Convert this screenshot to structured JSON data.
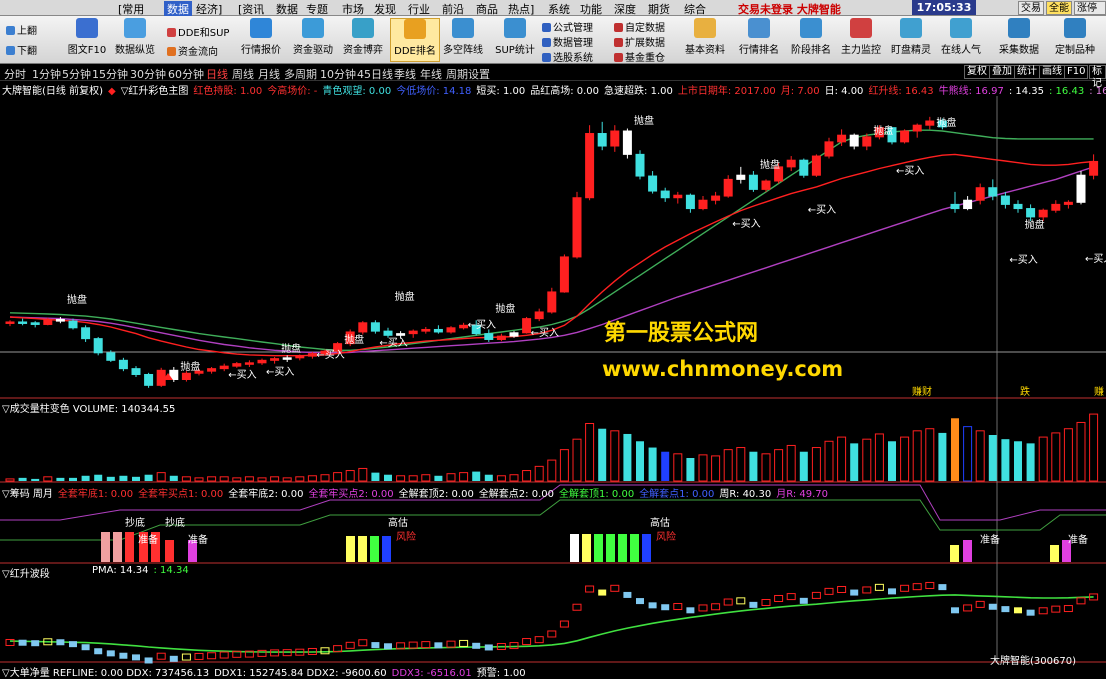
{
  "top_menu": {
    "items": [
      {
        "label": "[常用"
      },
      {
        "label": "数据",
        "active": true
      },
      {
        "label": "经济]"
      },
      {
        "label": "[资讯"
      },
      {
        "label": "数据"
      },
      {
        "label": "专题"
      },
      {
        "label": "市场"
      },
      {
        "label": "发现"
      },
      {
        "label": "行业"
      },
      {
        "label": "前沿"
      },
      {
        "label": "商品"
      },
      {
        "label": "热点]"
      },
      {
        "label": "系统"
      },
      {
        "label": "功能"
      },
      {
        "label": "深度"
      },
      {
        "label": "期货"
      },
      {
        "label": "综合"
      }
    ],
    "status": "交易未登录 大牌智能",
    "time": "17:05:33 日",
    "buttons": [
      "交易",
      "全能",
      "涨停王"
    ]
  },
  "toolbar": {
    "left_small": [
      "上翻",
      "下翻"
    ],
    "buttons": [
      {
        "label": "图文F10",
        "color": "#3b6fd0"
      },
      {
        "label": "数据纵览",
        "color": "#4a9ee0"
      },
      {
        "label": "行情报价",
        "color": "#2f86d8"
      },
      {
        "label": "资金驱动",
        "color": "#3c9bd8"
      },
      {
        "label": "资金博弈",
        "color": "#38a0c8"
      },
      {
        "label": "DDE排名",
        "color": "#e8a020",
        "active": true
      },
      {
        "label": "多空阵线",
        "color": "#3b8fd0"
      },
      {
        "label": "SUP统计",
        "color": "#3b8fd0"
      },
      {
        "label": "基本资料",
        "color": "#e8b040"
      },
      {
        "label": "行情排名",
        "color": "#4a90d0"
      },
      {
        "label": "阶段排名",
        "color": "#3b8fd0"
      },
      {
        "label": "主力监控",
        "color": "#d04040"
      },
      {
        "label": "盯盘精灵",
        "color": "#40a0d0"
      },
      {
        "label": "在线人气",
        "color": "#40a0d0"
      },
      {
        "label": "采集数据",
        "color": "#3080c0"
      },
      {
        "label": "定制品种",
        "color": "#3080c0"
      }
    ],
    "small_groups": [
      [
        "DDE和SUP",
        "资金流向"
      ],
      [
        "公式管理",
        "数据管理",
        "选股系统"
      ],
      [
        "自定数据",
        "扩展数据",
        "基金重仓"
      ]
    ]
  },
  "period_bar": {
    "items": [
      {
        "label": "分时"
      },
      {
        "label": "1分钟"
      },
      {
        "label": "5分钟"
      },
      {
        "label": "15分钟"
      },
      {
        "label": "30分钟"
      },
      {
        "label": "60分钟"
      },
      {
        "label": "日线",
        "active": true
      },
      {
        "label": "周线"
      },
      {
        "label": "月线"
      },
      {
        "label": "多周期"
      },
      {
        "label": "10分钟"
      },
      {
        "label": "45日线"
      },
      {
        "label": "季线"
      },
      {
        "label": "年线"
      },
      {
        "label": "周期设置"
      }
    ],
    "right_buttons": [
      "复权",
      "叠加",
      "统计",
      "画线",
      "F10",
      "标记"
    ]
  },
  "main_info": [
    {
      "text": "大牌智能(日线 前复权)",
      "color": "#ffffff"
    },
    {
      "text": "◆",
      "color": "#ff2020"
    },
    {
      "text": "▽红升彩色主图",
      "color": "#ffffff"
    },
    {
      "text": "红色持股: 1.00",
      "color": "#ff3030"
    },
    {
      "text": "今高场价: -",
      "color": "#ff3030"
    },
    {
      "text": "青色观望: 0.00",
      "color": "#40e0e0"
    },
    {
      "text": "今低场价: 14.18",
      "color": "#4060ff"
    },
    {
      "text": "短买: 1.00",
      "color": "#ffffff"
    },
    {
      "text": "品红高场: 0.00",
      "color": "#ffffff"
    },
    {
      "text": "急速超跌: 1.00",
      "color": "#ffffff"
    },
    {
      "text": "上市日期年: 2017.00",
      "color": "#ff3030"
    },
    {
      "text": "月: 7.00",
      "color": "#ff3030"
    },
    {
      "text": "日: 4.00",
      "color": "#ffffff"
    },
    {
      "text": "红升线: 16.43",
      "color": "#ff3030"
    },
    {
      "text": "牛熊线: 16.97",
      "color": "#e040e0"
    },
    {
      "text": ": 14.35",
      "color": "#ffffff"
    },
    {
      "text": ": 16.43",
      "color": "#40ff40"
    },
    {
      "text": ": 16.97",
      "color": "#e080e0"
    }
  ],
  "vol_info": [
    {
      "text": "▽成交量柱变色 VOLUME: 140344.55",
      "color": "#ffffff"
    }
  ],
  "chip_info": [
    {
      "text": "▽筹码 周月",
      "color": "#ffffff"
    },
    {
      "text": "全套牢底1: 0.00",
      "color": "#ff3030"
    },
    {
      "text": "全套牢买点1: 0.00",
      "color": "#ff3030"
    },
    {
      "text": "全套牢底2: 0.00",
      "color": "#ffffff"
    },
    {
      "text": "全套牢买点2: 0.00",
      "color": "#e040e0"
    },
    {
      "text": "全解套顶2: 0.00",
      "color": "#ffffff"
    },
    {
      "text": "全解套点2: 0.00",
      "color": "#ffffff"
    },
    {
      "text": "全解套顶1: 0.00",
      "color": "#40ff40"
    },
    {
      "text": "全解套点1: 0.00",
      "color": "#4060ff"
    },
    {
      "text": "周R: 40.30",
      "color": "#ffffff"
    },
    {
      "text": "月R: 49.70",
      "color": "#e040e0"
    }
  ],
  "wave_info": [
    {
      "text": "▽红升波段",
      "color": "#ffffff"
    }
  ],
  "wave_info2": [
    {
      "text": "PMA: 14.34",
      "color": "#ffffff"
    },
    {
      "text": ": 14.34",
      "color": "#40ff40"
    }
  ],
  "bottom_info": [
    {
      "text": "▽大单净量 REFLINE: 0.00 DDX: 737456.13",
      "color": "#ffffff"
    },
    {
      "text": "DDX1: 152745.84 DDX2: -9600.60",
      "color": "#ffffff"
    },
    {
      "text": "DDX3: -6516.01",
      "color": "#e040e0"
    },
    {
      "text": "预警: 1.00",
      "color": "#ffffff"
    }
  ],
  "stock_label": "大牌智能(300670)",
  "watermark": {
    "title": "第一股票公式网",
    "url": "www.chnmoney.com"
  },
  "chart_data": {
    "type": "candlestick",
    "ohlc": [
      [
        12.55,
        12.62,
        12.48,
        12.58
      ],
      [
        12.58,
        12.66,
        12.5,
        12.56
      ],
      [
        12.56,
        12.6,
        12.45,
        12.52
      ],
      [
        12.52,
        12.68,
        12.5,
        12.64
      ],
      [
        12.64,
        12.7,
        12.55,
        12.6
      ],
      [
        12.6,
        12.66,
        12.4,
        12.44
      ],
      [
        12.44,
        12.5,
        12.1,
        12.18
      ],
      [
        12.18,
        12.22,
        11.78,
        11.84
      ],
      [
        11.84,
        11.9,
        11.62,
        11.66
      ],
      [
        11.66,
        11.72,
        11.4,
        11.46
      ],
      [
        11.46,
        11.52,
        11.26,
        11.32
      ],
      [
        11.32,
        11.36,
        11.0,
        11.06
      ],
      [
        11.06,
        11.48,
        11.02,
        11.42
      ],
      [
        11.42,
        11.5,
        11.14,
        11.2
      ],
      [
        11.2,
        11.4,
        11.15,
        11.35
      ],
      [
        11.35,
        11.45,
        11.3,
        11.4
      ],
      [
        11.4,
        11.5,
        11.34,
        11.46
      ],
      [
        11.46,
        11.58,
        11.4,
        11.52
      ],
      [
        11.52,
        11.62,
        11.48,
        11.58
      ],
      [
        11.58,
        11.66,
        11.5,
        11.6
      ],
      [
        11.6,
        11.7,
        11.55,
        11.66
      ],
      [
        11.66,
        11.74,
        11.58,
        11.7
      ],
      [
        11.7,
        11.78,
        11.62,
        11.72
      ],
      [
        11.72,
        11.8,
        11.66,
        11.76
      ],
      [
        11.76,
        11.86,
        11.7,
        11.82
      ],
      [
        11.82,
        11.92,
        11.78,
        11.88
      ],
      [
        11.88,
        12.1,
        11.84,
        12.06
      ],
      [
        12.06,
        12.4,
        12.0,
        12.34
      ],
      [
        12.34,
        12.6,
        12.28,
        12.56
      ],
      [
        12.56,
        12.62,
        12.3,
        12.36
      ],
      [
        12.36,
        12.44,
        12.2,
        12.26
      ],
      [
        12.26,
        12.36,
        12.18,
        12.3
      ],
      [
        12.3,
        12.4,
        12.2,
        12.36
      ],
      [
        12.36,
        12.46,
        12.3,
        12.4
      ],
      [
        12.4,
        12.5,
        12.3,
        12.34
      ],
      [
        12.34,
        12.48,
        12.3,
        12.44
      ],
      [
        12.44,
        12.56,
        12.4,
        12.5
      ],
      [
        12.5,
        12.62,
        12.26,
        12.3
      ],
      [
        12.3,
        12.4,
        12.1,
        12.16
      ],
      [
        12.16,
        12.3,
        12.12,
        12.24
      ],
      [
        12.24,
        12.36,
        12.2,
        12.32
      ],
      [
        12.32,
        12.7,
        12.3,
        12.66
      ],
      [
        12.66,
        12.9,
        12.6,
        12.82
      ],
      [
        12.82,
        13.4,
        12.78,
        13.3
      ],
      [
        13.3,
        14.2,
        13.28,
        14.14
      ],
      [
        14.14,
        15.7,
        14.1,
        15.56
      ],
      [
        15.56,
        17.3,
        15.5,
        17.1
      ],
      [
        17.1,
        17.38,
        16.7,
        16.8
      ],
      [
        16.8,
        17.3,
        16.66,
        17.16
      ],
      [
        17.16,
        17.22,
        16.5,
        16.6
      ],
      [
        16.6,
        16.7,
        16.0,
        16.08
      ],
      [
        16.08,
        16.2,
        15.66,
        15.72
      ],
      [
        15.72,
        15.8,
        15.46,
        15.56
      ],
      [
        15.56,
        15.7,
        15.42,
        15.62
      ],
      [
        15.62,
        15.66,
        15.2,
        15.3
      ],
      [
        15.3,
        15.6,
        15.26,
        15.5
      ],
      [
        15.5,
        15.7,
        15.4,
        15.6
      ],
      [
        15.6,
        16.1,
        15.56,
        16.0
      ],
      [
        16.0,
        16.3,
        15.9,
        16.1
      ],
      [
        16.1,
        16.2,
        15.7,
        15.76
      ],
      [
        15.76,
        16.0,
        15.7,
        15.96
      ],
      [
        15.96,
        16.4,
        15.9,
        16.3
      ],
      [
        16.3,
        16.56,
        16.2,
        16.46
      ],
      [
        16.46,
        16.5,
        16.04,
        16.1
      ],
      [
        16.1,
        16.6,
        16.06,
        16.56
      ],
      [
        16.56,
        17.0,
        16.5,
        16.9
      ],
      [
        16.9,
        17.2,
        16.8,
        17.06
      ],
      [
        17.06,
        17.1,
        16.72,
        16.8
      ],
      [
        16.8,
        17.1,
        16.7,
        17.02
      ],
      [
        17.02,
        17.3,
        16.96,
        17.24
      ],
      [
        17.24,
        17.26,
        16.84,
        16.9
      ],
      [
        16.9,
        17.2,
        16.86,
        17.16
      ],
      [
        17.16,
        17.34,
        17.0,
        17.3
      ],
      [
        17.3,
        17.5,
        17.2,
        17.4
      ],
      [
        17.4,
        17.46,
        17.2,
        17.26
      ],
      [
        15.4,
        15.7,
        15.2,
        15.3
      ],
      [
        15.3,
        15.6,
        15.26,
        15.5
      ],
      [
        15.5,
        15.9,
        15.4,
        15.8
      ],
      [
        15.8,
        16.0,
        15.5,
        15.6
      ],
      [
        15.6,
        15.7,
        15.3,
        15.4
      ],
      [
        15.4,
        15.5,
        15.2,
        15.3
      ],
      [
        15.3,
        15.4,
        15.0,
        15.1
      ],
      [
        15.1,
        15.3,
        15.0,
        15.26
      ],
      [
        15.26,
        15.5,
        15.2,
        15.4
      ],
      [
        15.4,
        15.5,
        15.3,
        15.45
      ],
      [
        15.45,
        16.2,
        15.4,
        16.1
      ],
      [
        16.1,
        16.6,
        16.0,
        16.43
      ]
    ],
    "red_line": [
      12.7,
      12.68,
      12.66,
      12.64,
      12.62,
      12.6,
      12.57,
      12.52,
      12.46,
      12.38,
      12.3,
      12.2,
      12.12,
      12.05,
      11.98,
      11.92,
      11.88,
      11.84,
      11.81,
      11.79,
      11.78,
      11.77,
      11.77,
      11.77,
      11.78,
      11.79,
      11.82,
      11.87,
      11.93,
      11.98,
      12.02,
      12.06,
      12.09,
      12.12,
      12.14,
      12.16,
      12.18,
      12.2,
      12.21,
      12.22,
      12.23,
      12.26,
      12.3,
      12.38,
      12.5,
      12.72,
      13.02,
      13.3,
      13.56,
      13.8,
      14.0,
      14.2,
      14.38,
      14.54,
      14.7,
      14.84,
      14.98,
      15.12,
      15.25,
      15.36,
      15.46,
      15.56,
      15.66,
      15.74,
      15.82,
      15.92,
      16.02,
      16.1,
      16.18,
      16.26,
      16.33,
      16.4,
      16.47,
      16.53,
      16.58,
      16.6,
      16.56,
      16.52,
      16.48,
      16.44,
      16.4,
      16.36,
      16.34,
      16.34,
      16.36,
      16.4,
      16.43
    ],
    "magenta_line": [
      12.7,
      12.69,
      12.68,
      12.67,
      12.66,
      12.64,
      12.62,
      12.59,
      12.55,
      12.5,
      12.44,
      12.38,
      12.32,
      12.26,
      12.2,
      12.14,
      12.09,
      12.04,
      12.0,
      11.96,
      11.93,
      11.9,
      11.88,
      11.86,
      11.85,
      11.84,
      11.84,
      11.85,
      11.87,
      11.89,
      11.91,
      11.93,
      11.95,
      11.97,
      11.99,
      12.01,
      12.03,
      12.05,
      12.07,
      12.09,
      12.11,
      12.14,
      12.17,
      12.21,
      12.26,
      12.33,
      12.42,
      12.52,
      12.63,
      12.74,
      12.85,
      12.96,
      13.07,
      13.18,
      13.28,
      13.38,
      13.48,
      13.58,
      13.68,
      13.78,
      13.88,
      13.98,
      14.08,
      14.18,
      14.28,
      14.38,
      14.48,
      14.58,
      14.68,
      14.78,
      14.88,
      14.98,
      15.08,
      15.18,
      15.28,
      15.36,
      15.44,
      15.52,
      15.6,
      15.68,
      15.76,
      15.84,
      15.92,
      16.0,
      16.1,
      16.2,
      16.3
    ],
    "green_line": [
      12.8,
      12.79,
      12.78,
      12.77,
      12.76,
      12.74,
      12.72,
      12.69,
      12.65,
      12.6,
      12.55,
      12.5,
      12.45,
      12.4,
      12.35,
      12.3,
      12.26,
      12.22,
      12.18,
      12.14,
      12.1,
      12.06,
      12.02,
      11.98,
      11.95,
      11.92,
      11.9,
      11.9,
      11.92,
      11.95,
      11.98,
      12.02,
      12.06,
      12.1,
      12.14,
      12.18,
      12.22,
      12.26,
      12.3,
      12.34,
      12.38,
      12.42,
      12.46,
      12.52,
      12.6,
      12.72,
      12.9,
      13.1,
      13.3,
      13.5,
      13.7,
      13.9,
      14.1,
      14.3,
      14.5,
      14.7,
      14.9,
      15.1,
      15.3,
      15.5,
      15.7,
      15.9,
      16.1,
      16.3,
      16.5,
      16.7,
      16.9,
      17.0,
      17.06,
      17.1,
      17.14,
      17.16,
      17.18,
      17.18,
      17.16,
      17.12,
      17.08,
      17.04,
      17.0,
      16.98,
      16.97,
      16.97,
      16.97,
      16.97,
      16.97,
      16.97,
      16.97
    ],
    "volume": [
      2,
      3,
      2,
      4,
      3,
      3,
      5,
      6,
      4,
      5,
      4,
      6,
      8,
      5,
      4,
      3,
      4,
      4,
      3,
      4,
      3,
      4,
      3,
      4,
      5,
      6,
      8,
      10,
      12,
      8,
      6,
      5,
      5,
      6,
      5,
      7,
      8,
      9,
      6,
      5,
      6,
      10,
      14,
      20,
      30,
      40,
      55,
      50,
      48,
      45,
      38,
      32,
      28,
      26,
      22,
      25,
      24,
      30,
      32,
      28,
      26,
      30,
      34,
      28,
      32,
      38,
      42,
      36,
      40,
      45,
      38,
      42,
      48,
      50,
      46,
      60,
      52,
      48,
      44,
      40,
      38,
      36,
      42,
      46,
      50,
      56,
      64
    ],
    "annotations": [
      "抛盘",
      "买入",
      "抄底",
      "准备",
      "高估",
      "风险",
      "赚财",
      "跌",
      "赚"
    ]
  }
}
